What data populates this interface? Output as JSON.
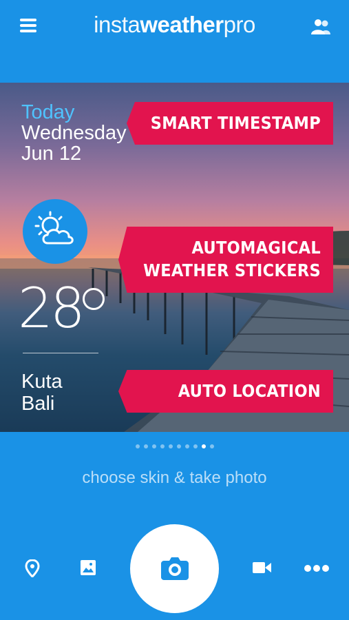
{
  "header": {
    "title_light_1": "insta",
    "title_bold": "weather",
    "title_light_2": "pro"
  },
  "photo": {
    "date": {
      "today": "Today",
      "day": "Wednesday",
      "date": "Jun 12"
    },
    "weather_icon": "partly-cloudy-icon",
    "temperature": "28",
    "location": {
      "city": "Kuta",
      "region": "Bali"
    },
    "banners": {
      "timestamp": "SMART TIMESTAMP",
      "stickers_line1": "AUTOMAGICAL",
      "stickers_line2": "WEATHER STICKERS",
      "location": "AUTO LOCATION"
    }
  },
  "pager": {
    "count": 10,
    "active_index": 8
  },
  "caption": "choose skin & take photo",
  "bottom_bar": {
    "icons": [
      "location-pin-icon",
      "gallery-icon",
      "camera-icon",
      "video-icon",
      "more-icon"
    ]
  },
  "colors": {
    "background": "#1a92e6",
    "banner": "#e2144e",
    "today_accent": "#4fc3ff"
  }
}
